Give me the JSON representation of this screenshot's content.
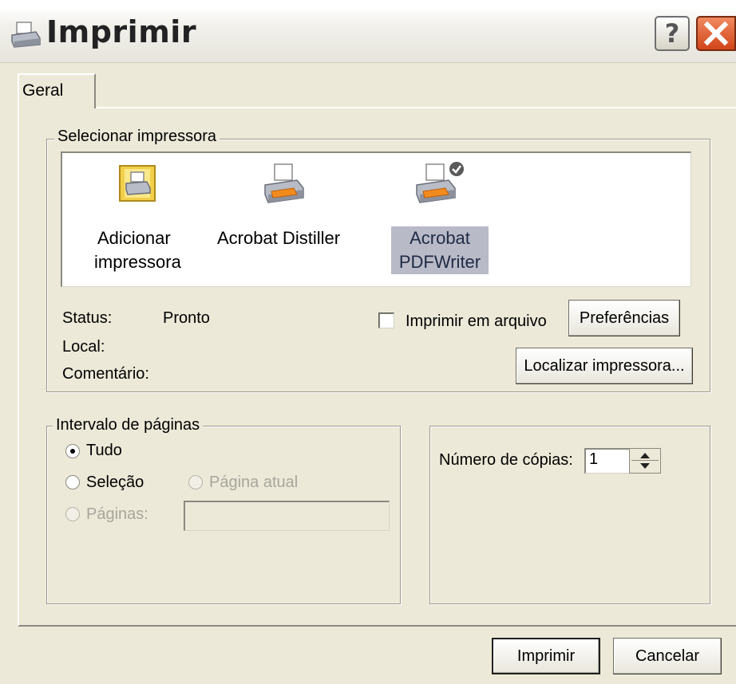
{
  "window": {
    "title": "Imprimir"
  },
  "tabs": [
    {
      "label": "Geral"
    }
  ],
  "select_printer": {
    "legend": "Selecionar impressora",
    "printers": [
      {
        "label_line1": "Adicionar",
        "label_line2": "impressora"
      },
      {
        "label_line1": "Acrobat Distiller",
        "label_line2": ""
      },
      {
        "label_line1": "Acrobat",
        "label_line2": "PDFWriter",
        "selected": true
      }
    ],
    "status_label": "Status:",
    "status_value": "Pronto",
    "location_label": "Local:",
    "comment_label": "Comentário:",
    "print_to_file_label": "Imprimir em arquivo",
    "print_to_file_checked": false,
    "preferences_button": "Preferências",
    "find_printer_button": "Localizar impressora..."
  },
  "page_range": {
    "legend": "Intervalo de páginas",
    "all_label": "Tudo",
    "selection_label": "Seleção",
    "current_page_label": "Página atual",
    "pages_label": "Páginas:",
    "pages_value": "",
    "selected_option": "all"
  },
  "copies": {
    "label": "Número de cópias:",
    "value": "1"
  },
  "footer": {
    "print_button": "Imprimir",
    "cancel_button": "Cancelar"
  },
  "colors": {
    "dialog_background": "#ece9d8",
    "selected_item_highlight": "#b9bac8",
    "close_button": "#d2451a"
  }
}
